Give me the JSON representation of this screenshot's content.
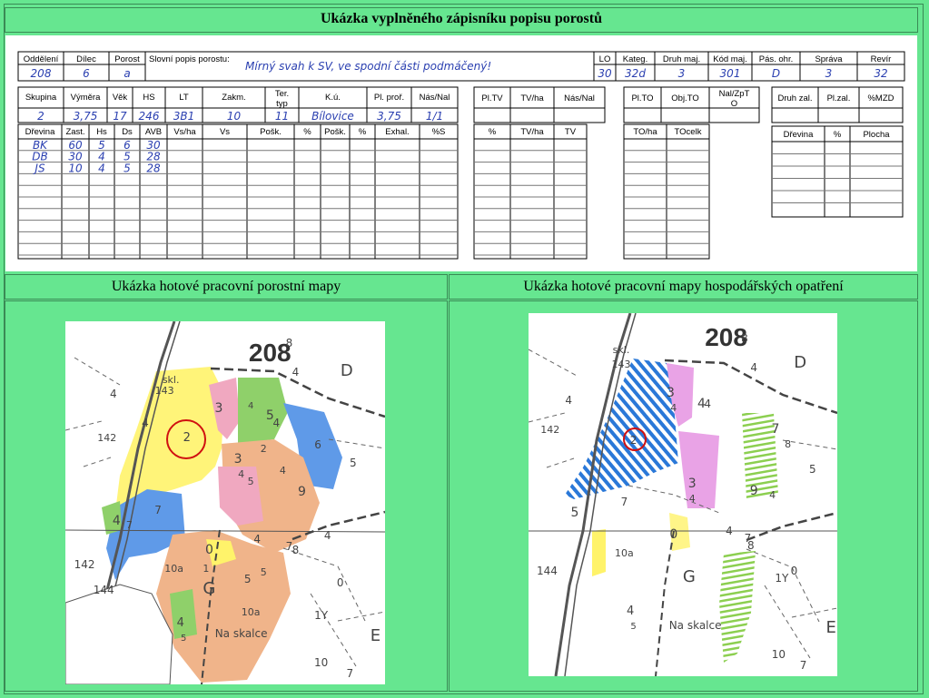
{
  "page": {
    "title": "Ukázka vyplněného zápisníku popisu porostů",
    "left_title": "Ukázka hotové pracovní porostní mapy",
    "right_title": "Ukázka hotové pracovní  mapy hospodářských opatření"
  },
  "form": {
    "row1": [
      {
        "label": "Oddělení",
        "value": "208"
      },
      {
        "label": "Dílec",
        "value": "6"
      },
      {
        "label": "Porost",
        "value": "a"
      },
      {
        "label": "Slovní popis porostu:",
        "value": "Mírný svah k SV, ve spodní části podmáčený!"
      },
      {
        "label": "LO",
        "value": "30"
      },
      {
        "label": "Kateg.",
        "value": "32d"
      },
      {
        "label": "Druh maj.",
        "value": "3"
      },
      {
        "label": "Kód maj.",
        "value": "301"
      },
      {
        "label": "Pás. ohr.",
        "value": "D"
      },
      {
        "label": "Správa",
        "value": "3"
      },
      {
        "label": "Revír",
        "value": "32"
      }
    ],
    "row2": [
      {
        "label": "Skupina",
        "value": "2"
      },
      {
        "label": "Výměra",
        "value": "3,75"
      },
      {
        "label": "Věk",
        "value": "17"
      },
      {
        "label": "HS",
        "value": "246"
      },
      {
        "label": "LT",
        "value": "3B1"
      },
      {
        "label": "Zakm.",
        "value": "10"
      },
      {
        "label": "Ter. typ",
        "value": "11"
      },
      {
        "label": "K.ú.",
        "value": "Bílovice"
      },
      {
        "label": "Pl. proř.",
        "value": "3,75"
      },
      {
        "label": "Nás/Nal",
        "value": "1/1"
      }
    ],
    "group_b": [
      "Pl.TV",
      "TV/ha",
      "Nás/Nal"
    ],
    "group_c": [
      "Pl.TO",
      "Obj.TO",
      "Nal/ZpTO"
    ],
    "group_d": [
      "Druh zal.",
      "Pl.zal.",
      "%MZD"
    ],
    "species_headers": [
      "Dřevina",
      "Zast.",
      "Hs",
      "Ds",
      "AVB",
      "Vs/ha",
      "Vs",
      "Pošk.",
      "%",
      "Pošk.",
      "%",
      "Exhal.",
      "%S"
    ],
    "species_rows": [
      [
        "BK",
        "60",
        "5",
        "6",
        "30"
      ],
      [
        "DB",
        "30",
        "4",
        "5",
        "28"
      ],
      [
        "JS",
        "10",
        "4",
        "5",
        "28"
      ]
    ],
    "tv_headers": [
      "%",
      "TV/ha",
      "TV"
    ],
    "to_headers": [
      "TO/ha",
      "TOcelk"
    ],
    "zal_headers": [
      "Dřevina",
      "%",
      "Plocha"
    ]
  },
  "maps": {
    "left": {
      "district": "208",
      "labels": [
        "8",
        "4",
        "D",
        "4",
        "4",
        "5",
        "142",
        "skl.",
        "143",
        "4",
        "2",
        "5",
        "4",
        "3",
        "3",
        "4",
        "5",
        "2",
        "6",
        "4",
        "9",
        "7",
        "4",
        "7",
        "0",
        "4",
        "7",
        "8",
        "5",
        "4",
        "1",
        "10a",
        "142",
        "144",
        "G",
        "5",
        "10a",
        "1Y",
        "0",
        "Na skalce",
        "10",
        "E",
        "7",
        "4",
        "5"
      ]
    },
    "right": {
      "district": "208",
      "labels": [
        "8",
        "4",
        "D",
        "4",
        "4",
        "5",
        "142",
        "skl.",
        "143",
        "3",
        "4",
        "4",
        "2",
        "7",
        "8",
        "3",
        "4",
        "9",
        "4",
        "7",
        "5",
        "0",
        "4",
        "7",
        "8",
        "10a",
        "144",
        "G",
        "1Y",
        "0",
        "Na skalce",
        "10",
        "E",
        "7",
        "4",
        "5"
      ]
    }
  },
  "colors": {
    "background": "#66e690",
    "border": "#3a8a55",
    "ink": "#2a3fb0",
    "yellow": "#fff36a",
    "pink": "#f0a8c0",
    "green": "#8fd06a",
    "blue": "#5f9ae8",
    "orange": "#f0b48a",
    "violet": "#e9a3e6",
    "hatch_blue": "#2a78d8"
  }
}
